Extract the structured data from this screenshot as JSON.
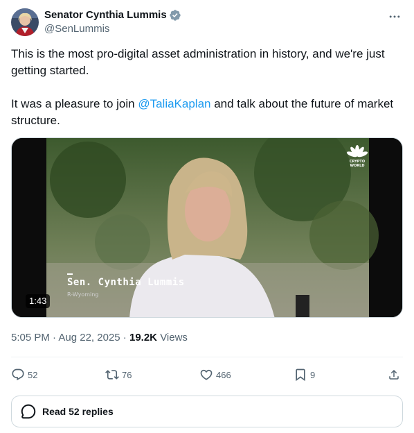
{
  "author": {
    "name": "Senator Cynthia Lummis",
    "handle": "@SenLummis",
    "verified_color": "#829aab"
  },
  "tweet": {
    "line1": "This is the most pro-digital asset administration in history, and we're just getting started.",
    "line2_before": "It was a pleasure to join ",
    "mention": "@TaliaKaplan",
    "line2_after": " and talk about the future of market structure."
  },
  "video": {
    "duration": "1:43",
    "lower_third_name": "Sen. Cynthia Lummis",
    "lower_third_sub": "R-Wyoming",
    "logo_text": "CRYPTO WORLD"
  },
  "meta": {
    "time": "5:05 PM",
    "date": "Aug 22, 2025",
    "views_count": "19.2K",
    "views_label": "Views"
  },
  "actions": {
    "replies": "52",
    "reposts": "76",
    "likes": "466",
    "bookmarks": "9"
  },
  "read_replies": "Read 52 replies",
  "colors": {
    "accent": "#1d9bf0",
    "text": "#0f1419",
    "secondary": "#536471"
  }
}
